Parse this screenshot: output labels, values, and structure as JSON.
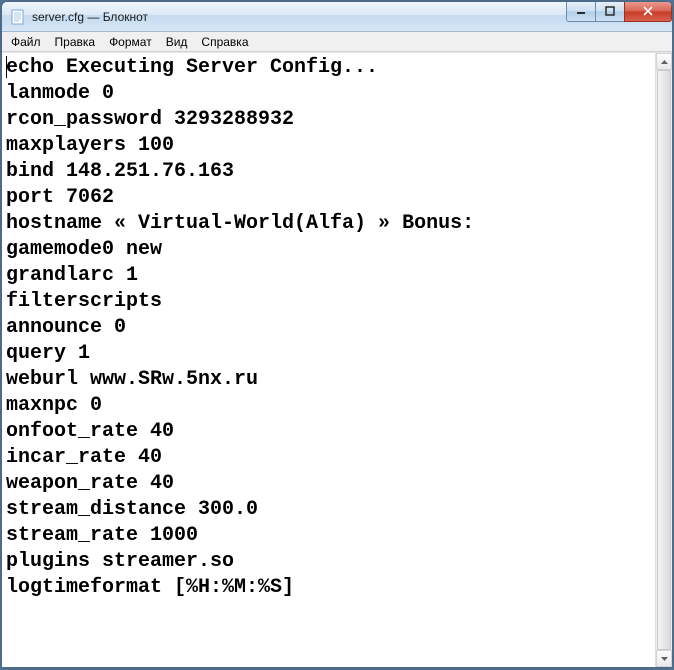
{
  "window": {
    "title": "server.cfg — Блокнот"
  },
  "menu": {
    "file": "Файл",
    "edit": "Правка",
    "format": "Формат",
    "view": "Вид",
    "help": "Справка"
  },
  "content": {
    "lines": [
      "echo Executing Server Config...",
      "lanmode 0",
      "rcon_password 3293288932",
      "maxplayers 100",
      "bind 148.251.76.163",
      "port 7062",
      "hostname « Virtual-World(Alfa) » Bonus:",
      "gamemode0 new",
      "grandlarc 1",
      "filterscripts",
      "announce 0",
      "query 1",
      "weburl www.SRw.5nx.ru",
      "maxnpc 0",
      "onfoot_rate 40",
      "incar_rate 40",
      "weapon_rate 40",
      "stream_distance 300.0",
      "stream_rate 1000",
      "plugins streamer.so",
      "logtimeformat [%H:%M:%S]"
    ]
  }
}
